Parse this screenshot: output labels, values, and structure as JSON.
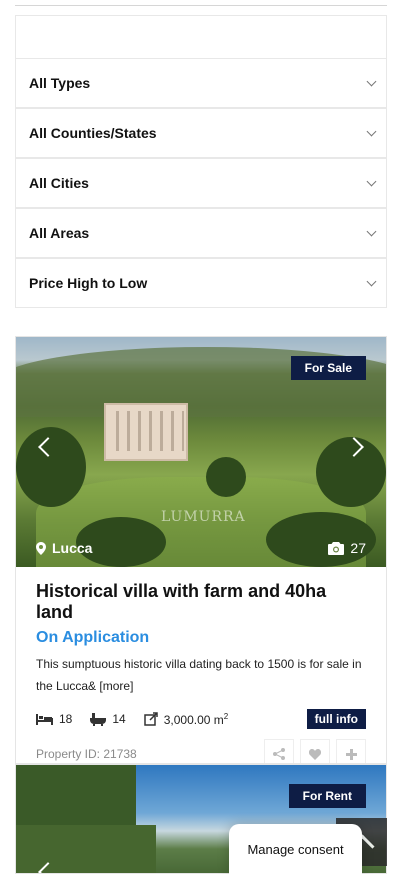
{
  "filters": {
    "type": "All Types",
    "county": "All Counties/States",
    "city": "All Cities",
    "area": "All Areas",
    "sort": "Price High to Low"
  },
  "listings": [
    {
      "status": "For Sale",
      "location": "Lucca",
      "photo_count": "27",
      "watermark": "LUMURRA",
      "title": "Historical villa with farm and 40ha land",
      "price": "On Application",
      "description": "This sumptuous historic villa dating back to 1500 is for sale in the Lucca&",
      "more_label": "[more]",
      "bedrooms": "18",
      "bathrooms": "14",
      "area_value": "3,000.00 m",
      "area_sup": "2",
      "full_info_label": "full info",
      "property_id": "Property ID: 21738"
    },
    {
      "status": "For Rent"
    }
  ],
  "consent": {
    "label": "Manage consent"
  },
  "colors": {
    "navy": "#0e1d45",
    "accent": "#2a8de0"
  },
  "icons": [
    "map-marker-icon",
    "camera-icon",
    "bed-icon",
    "bath-icon",
    "area-icon",
    "share-icon",
    "heart-icon",
    "plus-icon",
    "chevron-left-icon",
    "chevron-right-icon",
    "chevron-down-icon",
    "arrow-up-icon"
  ]
}
